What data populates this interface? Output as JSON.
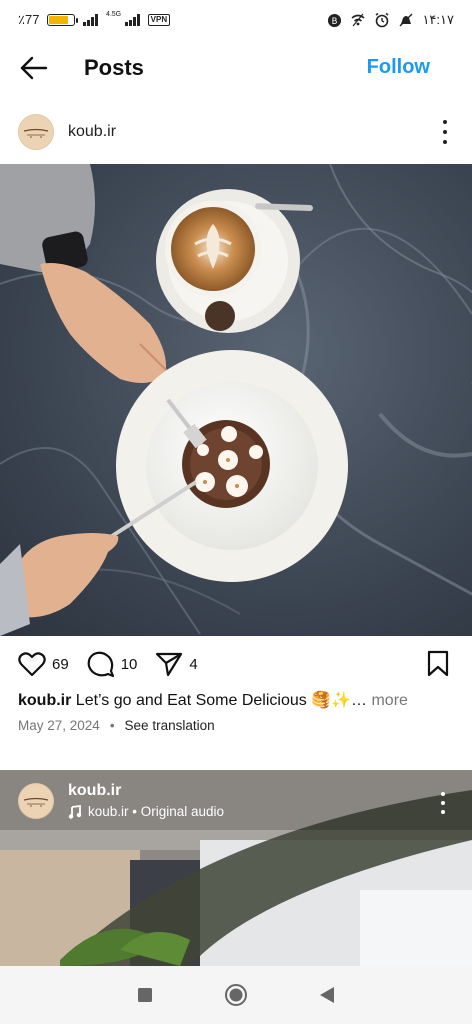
{
  "status_bar": {
    "battery_text": "٪77",
    "battery_level": 0.77,
    "network_label": "4.5G",
    "vpn_label": "VPN",
    "time": "۱۴:۱۷"
  },
  "header": {
    "title": "Posts",
    "follow_label": "Follow"
  },
  "post": {
    "username": "koub.ir",
    "likes": "69",
    "comments": "10",
    "shares": "4",
    "caption_user": "koub.ir",
    "caption_text": " Let’s go and Eat Some Delicious 🥞✨…",
    "caption_more": " more",
    "date": "May 27, 2024",
    "separator": "•",
    "see_translation": "See translation"
  },
  "reel": {
    "username": "koub.ir",
    "audio_text": "koub.ir • Original audio"
  },
  "icons": {
    "back": "arrow-left-icon",
    "like": "heart-icon",
    "comment": "comment-icon",
    "share": "send-icon",
    "save": "bookmark-icon",
    "music": "music-note-icon"
  },
  "colors": {
    "accent": "#1a9bf0",
    "battery": "#f4b400",
    "muted": "#777777"
  }
}
